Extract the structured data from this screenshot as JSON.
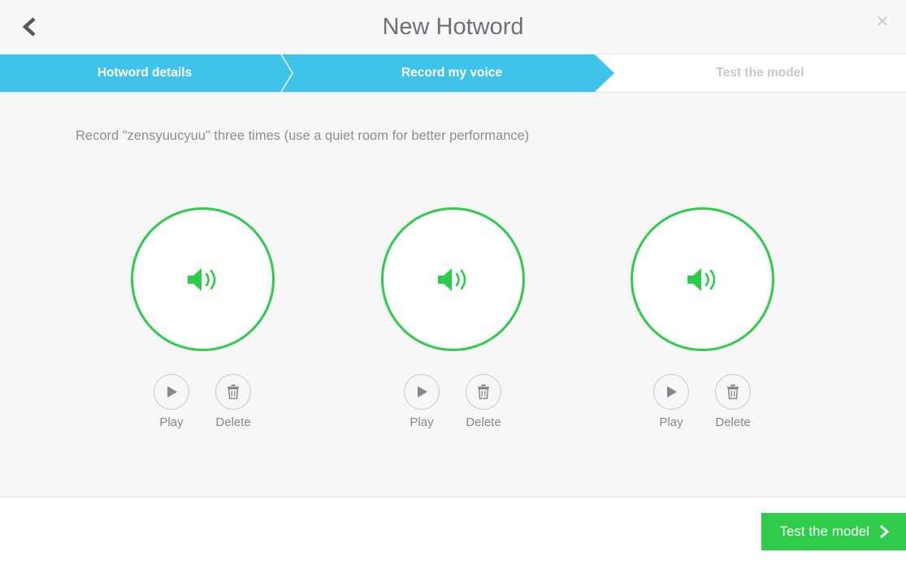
{
  "header": {
    "title": "New Hotword",
    "back_icon": "chevron-left-icon",
    "close_icon": "close-icon"
  },
  "steps": [
    {
      "label": "Hotword details",
      "state": "completed"
    },
    {
      "label": "Record my voice",
      "state": "active"
    },
    {
      "label": "Test the model",
      "state": "upcoming"
    }
  ],
  "main": {
    "instruction": "Record \"zensyuucyuu\" three times (use a quiet room for better performance)",
    "hotword": "zensyuucyuu",
    "recorders": [
      {
        "state": "recorded",
        "icon": "speaker-volume-icon",
        "play_label": "Play",
        "delete_label": "Delete"
      },
      {
        "state": "recorded",
        "icon": "speaker-volume-icon",
        "play_label": "Play",
        "delete_label": "Delete"
      },
      {
        "state": "recorded",
        "icon": "speaker-volume-icon",
        "play_label": "Play",
        "delete_label": "Delete"
      }
    ]
  },
  "footer": {
    "primary_label": "Test the model",
    "primary_icon": "chevron-right-icon"
  },
  "colors": {
    "accent_blue": "#3fc3e8",
    "accent_green": "#2ecc4a",
    "body_bg": "#f7f7f7",
    "header_bg": "#f8f8f8",
    "muted_text": "#8a8f96",
    "disabled_text": "#c9c9c9"
  }
}
